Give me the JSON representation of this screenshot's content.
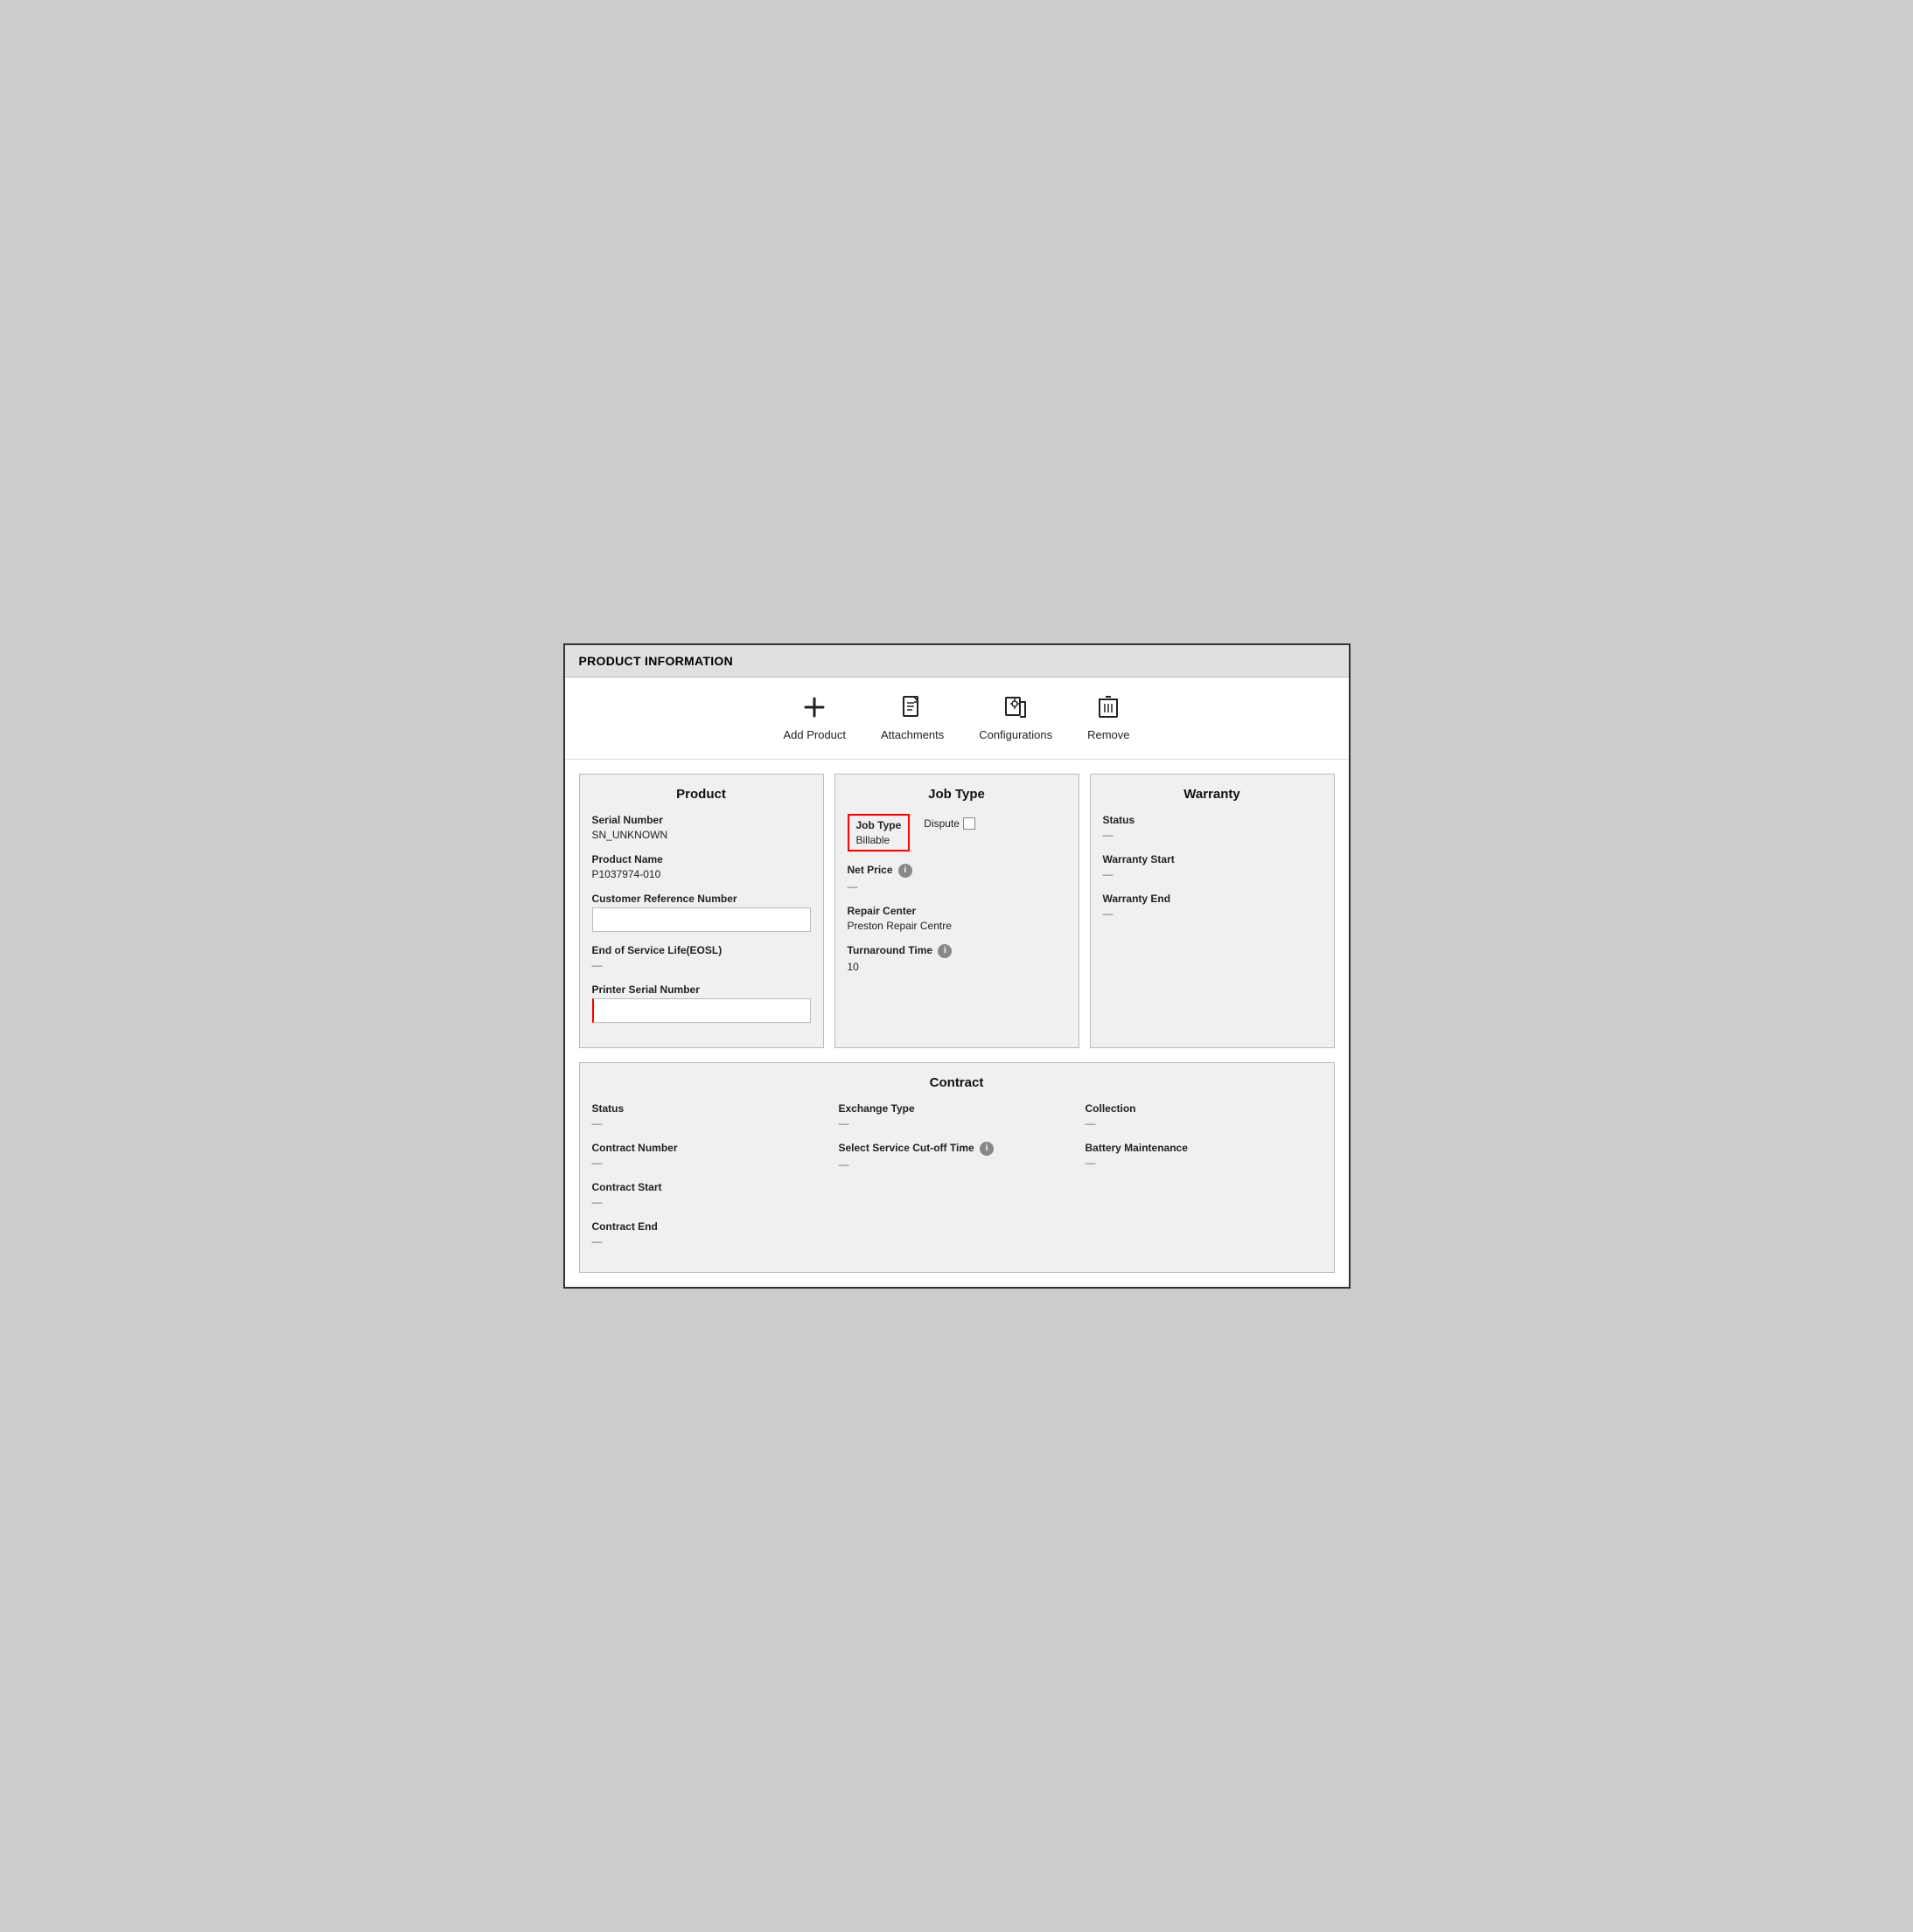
{
  "header": {
    "title": "PRODUCT INFORMATION"
  },
  "toolbar": {
    "items": [
      {
        "id": "add-product",
        "label": "Add Product",
        "icon": "plus"
      },
      {
        "id": "attachments",
        "label": "Attachments",
        "icon": "doc"
      },
      {
        "id": "configurations",
        "label": "Configurations",
        "icon": "config"
      },
      {
        "id": "remove",
        "label": "Remove",
        "icon": "trash"
      }
    ]
  },
  "product_panel": {
    "title": "Product",
    "fields": [
      {
        "label": "Serial Number",
        "value": "SN_UNKNOWN",
        "type": "text"
      },
      {
        "label": "Product Name",
        "value": "P1037974-010",
        "type": "text"
      },
      {
        "label": "Customer Reference Number",
        "value": "",
        "type": "input"
      },
      {
        "label": "End of Service Life(EOSL)",
        "value": "—",
        "type": "text"
      },
      {
        "label": "Printer Serial Number",
        "value": "",
        "type": "input-red"
      }
    ]
  },
  "job_type_panel": {
    "title": "Job Type",
    "job_type_label": "Job Type",
    "job_type_value": "Billable",
    "dispute_label": "Dispute",
    "net_price_label": "Net Price",
    "net_price_value": "—",
    "repair_center_label": "Repair Center",
    "repair_center_value": "Preston Repair Centre",
    "turnaround_label": "Turnaround Time",
    "turnaround_value": "10"
  },
  "warranty_panel": {
    "title": "Warranty",
    "status_label": "Status",
    "status_value": "—",
    "warranty_start_label": "Warranty Start",
    "warranty_start_value": "—",
    "warranty_end_label": "Warranty End",
    "warranty_end_value": "—"
  },
  "contract_section": {
    "title": "Contract",
    "col1": [
      {
        "label": "Status",
        "value": "—"
      },
      {
        "label": "Contract Number",
        "value": "—"
      },
      {
        "label": "Contract Start",
        "value": "—"
      },
      {
        "label": "Contract End",
        "value": "—"
      }
    ],
    "col2": [
      {
        "label": "Exchange Type",
        "value": "—"
      },
      {
        "label": "Select Service Cut-off Time",
        "has_info": true,
        "value": "—"
      }
    ],
    "col3": [
      {
        "label": "Collection",
        "value": "—"
      },
      {
        "label": "Battery Maintenance",
        "value": "—"
      }
    ]
  }
}
